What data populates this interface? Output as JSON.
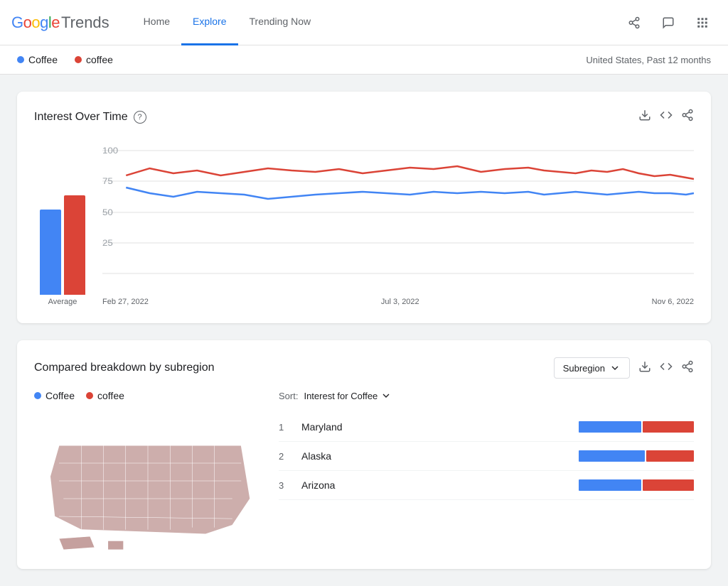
{
  "header": {
    "logo_google": "Google",
    "logo_trends": "Trends",
    "nav": [
      {
        "label": "Home",
        "active": false
      },
      {
        "label": "Explore",
        "active": true
      },
      {
        "label": "Trending Now",
        "active": false
      }
    ],
    "icons": [
      "share-icon",
      "message-icon",
      "apps-icon"
    ]
  },
  "search_bar": {
    "term1": "Coffee",
    "term2": "coffee",
    "geo_info": "United States, Past 12 months"
  },
  "interest_chart": {
    "title": "Interest Over Time",
    "help_tooltip": "?",
    "actions": [
      "download-icon",
      "embed-icon",
      "share-icon"
    ],
    "average_label": "Average",
    "x_labels": [
      "Feb 27, 2022",
      "Jul 3, 2022",
      "Nov 6, 2022"
    ],
    "y_labels": [
      "100",
      "75",
      "50",
      "25"
    ],
    "bar_blue_height": 120,
    "bar_red_height": 140
  },
  "breakdown": {
    "title": "Compared breakdown by subregion",
    "subregion_btn": "Subregion",
    "actions": [
      "download-icon",
      "embed-icon",
      "share-icon"
    ],
    "term1": "Coffee",
    "term2": "coffee",
    "sort_label": "Sort:",
    "sort_value": "Interest for Coffee",
    "regions": [
      {
        "rank": 1,
        "name": "Maryland",
        "blue_pct": 55,
        "red_pct": 45
      },
      {
        "rank": 2,
        "name": "Alaska",
        "blue_pct": 58,
        "red_pct": 42
      },
      {
        "rank": 3,
        "name": "Arizona",
        "blue_pct": 55,
        "red_pct": 45
      }
    ]
  }
}
